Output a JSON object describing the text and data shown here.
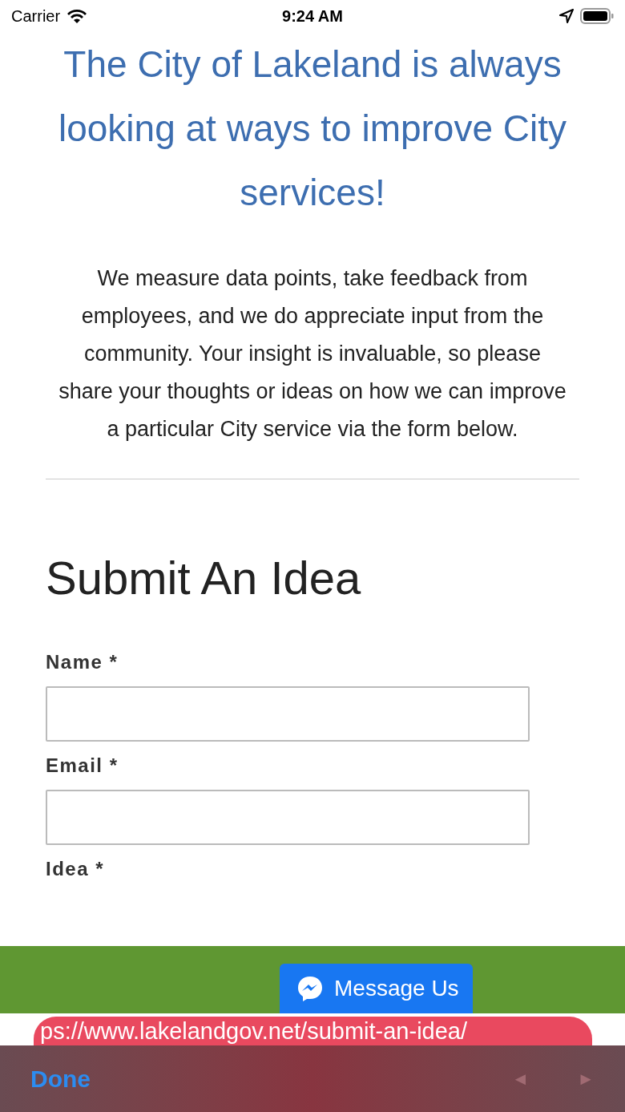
{
  "status_bar": {
    "carrier": "Carrier",
    "time": "9:24 AM"
  },
  "heading": "The City of Lakeland is always looking at ways to improve City services!",
  "intro": "We measure data points, take feedback from employees, and we do appreciate input from the community. Your insight is invaluable, so please share your thoughts or ideas on how we can improve a particular City service via the form below.",
  "form": {
    "title": "Submit An Idea",
    "fields": [
      {
        "label": "Name *",
        "kind": "input"
      },
      {
        "label": "Email *",
        "kind": "input"
      },
      {
        "label": "Idea *",
        "kind": "label"
      }
    ]
  },
  "message_button": "Message Us",
  "url": "ps://www.lakelandgov.net/submit-an-idea/",
  "toolbar": {
    "done": "Done",
    "buttons": [
      {
        "label": "◄",
        "disabled": true
      },
      {
        "label": "►",
        "disabled": true
      }
    ]
  }
}
